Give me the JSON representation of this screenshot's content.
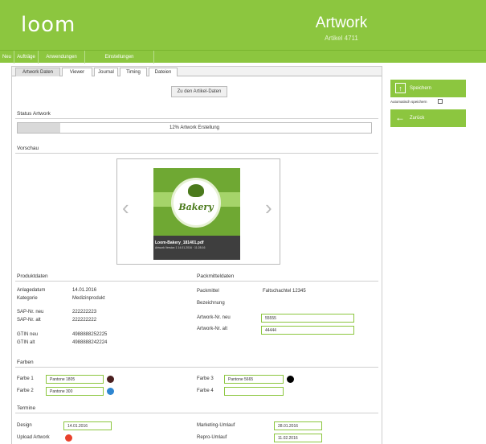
{
  "header": {
    "logo": "loom",
    "title": "Artwork",
    "subtitle": "Artikel 4711"
  },
  "menu": [
    "Neu",
    "Aufträge",
    "Anwendungen",
    "Einstellungen"
  ],
  "tabs": [
    "Artwork Daten",
    "Viewer",
    "Journal",
    "Timing",
    "Dateien"
  ],
  "actions": {
    "artikel_daten": "Zu den Artikel-Daten"
  },
  "status": {
    "title": "Status Artwork",
    "progress": 0.12,
    "text": "12% Artwork Erstellung"
  },
  "preview": {
    "title": "Vorschau",
    "filename": "Loom-Bakery_181401.pdf",
    "meta": "Artwork Version 1 14.01.2016 · 11:28:16",
    "logo_text": "Bakery"
  },
  "produktdaten": {
    "title": "Produktdaten",
    "anlagedatum_label": "Anlagedatum",
    "anlagedatum": "14.01.2016",
    "kategorie_label": "Kategorie",
    "kategorie": "Medizinprodukt",
    "sap_neu_label": "SAP-Nr. neu",
    "sap_neu": "222222223",
    "sap_alt_label": "SAP-Nr. alt",
    "sap_alt": "222222222",
    "gtin_neu_label": "GTIN neu",
    "gtin_neu": "4988888252225",
    "gtin_alt_label": "GTIN alt",
    "gtin_alt": "4988888242224"
  },
  "packmitteldaten": {
    "title": "Packmitteldaten",
    "packmittel_label": "Packmittel",
    "packmittel": "Faltschachtel 12345",
    "bezeichnung_label": "Bezeichnung",
    "artwork_neu_label": "Artwork-Nr. neu",
    "artwork_neu": "55555",
    "artwork_alt_label": "Artwork-Nr. alt",
    "artwork_alt": "44444"
  },
  "farben": {
    "title": "Farben",
    "farbe1_label": "Farbe 1",
    "farbe1": "Pantone 1805",
    "farbe1_color": "#4a1f1f",
    "farbe2_label": "Farbe 2",
    "farbe2": "Pantone 300",
    "farbe2_color": "#2e86d1",
    "farbe3_label": "Farbe 3",
    "farbe3": "Pantone 5665",
    "farbe3_color": "#000000",
    "farbe4_label": "Farbe 4",
    "farbe4": ""
  },
  "termine": {
    "title": "Termine",
    "design_label": "Design",
    "design": "14.01.2016",
    "upload_label": "Upload Artwork",
    "upload_color": "#e8412c",
    "marketing_label": "Marketing-Umlauf",
    "marketing": "28.01.2016",
    "repro_label": "Repro-Umlauf",
    "repro": "11.02.2016"
  },
  "sidebar": {
    "save": "Speichern",
    "autosave": "Automatisch speichern",
    "back": "Zurück"
  }
}
